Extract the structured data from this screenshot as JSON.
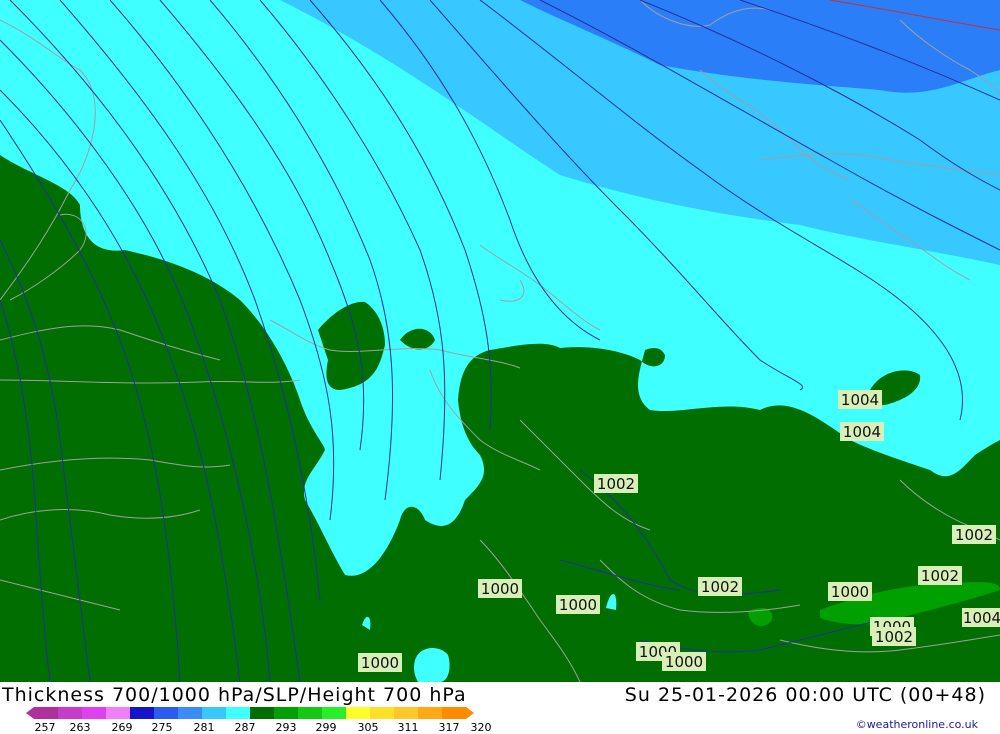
{
  "title": "Thickness 700/1000 hPa/SLP/Height 700 hPa",
  "valid_time": "Su 25-01-2026 00:00 UTC (00+48)",
  "credit": "©weatheronline.co.uk",
  "colorbar": {
    "ticks": [
      "257",
      "263",
      "269",
      "275",
      "281",
      "287",
      "293",
      "299",
      "305",
      "311",
      "317",
      "320"
    ],
    "colors": [
      "#b0309c",
      "#c83ccc",
      "#e040f0",
      "#f080f8",
      "#1414c8",
      "#2a5cf0",
      "#3c8cf8",
      "#36c8ff",
      "#40ffff",
      "#006e00",
      "#00a000",
      "#14c814",
      "#28f028",
      "#ffff28",
      "#ffe028",
      "#ffc828",
      "#ffaa14",
      "#ff8c00"
    ]
  },
  "isobar_labels": [
    "1004",
    "1004",
    "1002",
    "1002",
    "1000",
    "1000",
    "1002",
    "1000",
    "1002",
    "1000",
    "1002",
    "1004",
    "1000",
    "1000",
    "1000"
  ],
  "map_colors": {
    "deep_blue": "#2a7ff8",
    "mid_blue": "#36c8ff",
    "cyan": "#40ffff",
    "green": "#006e00",
    "light_green": "#00a000",
    "isobar": "#2030a0",
    "coast": "#a0a0a0",
    "label_bg": "#d8f0b8"
  }
}
